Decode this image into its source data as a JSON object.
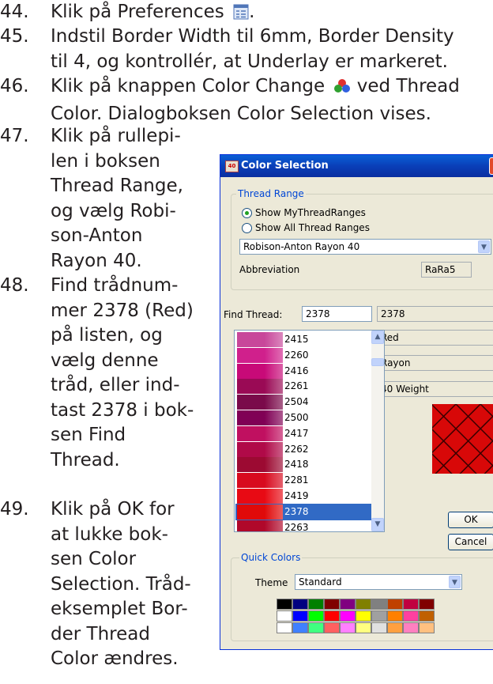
{
  "steps": [
    {
      "num": "44.",
      "lines": [
        "Klik på Preferences"
      ],
      "icon": "preferences-icon"
    },
    {
      "num": "45.",
      "lines": [
        "Indstil Border Width til 6mm, Border Density",
        "til 4, og kontrollér, at Underlay er markeret."
      ]
    },
    {
      "num": "46.",
      "lines": [
        "Klik på knappen Color Change",
        "Color. Dialogboksen Color Selection vises."
      ],
      "line1_tail": "ved Thread",
      "icon": "color-change-icon"
    },
    {
      "num": "47.",
      "lines": [
        "Klik på rullepi-",
        "len i boksen",
        "Thread Range,",
        "og vælg Robi-",
        "son-Anton",
        "Rayon 40."
      ]
    },
    {
      "num": "48.",
      "lines": [
        "Find trådnum-",
        "mer 2378 (Red)",
        "på listen, og",
        "vælg denne",
        "tråd, eller ind-",
        "tast 2378 i bok-",
        "sen Find",
        "Thread."
      ]
    },
    {
      "num": "49.",
      "lines": [
        "Klik på OK for",
        "at lukke bok-",
        "sen Color",
        "Selection. Tråd-",
        "eksemplet Bor-",
        "der Thread",
        "Color ændres."
      ]
    }
  ],
  "dialog": {
    "title": "Color Selection",
    "title_icon_text": "40",
    "close": "X",
    "thread_range": {
      "label": "Thread Range",
      "radio1": "Show MyThreadRanges",
      "radio2": "Show All Thread Ranges",
      "selected": "Robison-Anton Rayon 40",
      "abbr_label": "Abbreviation",
      "abbr_value": "RaRa5"
    },
    "find_label": "Find Thread:",
    "find_value": "2378",
    "info": [
      "2378",
      "Red",
      "Rayon",
      "40 Weight"
    ],
    "threads": [
      {
        "n": "2415",
        "c": "#c8479a"
      },
      {
        "n": "2260",
        "c": "#d0208c"
      },
      {
        "n": "2416",
        "c": "#c80a78"
      },
      {
        "n": "2261",
        "c": "#9a0a55"
      },
      {
        "n": "2504",
        "c": "#7a0a4a"
      },
      {
        "n": "2500",
        "c": "#800055"
      },
      {
        "n": "2417",
        "c": "#c01060"
      },
      {
        "n": "2262",
        "c": "#b00a48"
      },
      {
        "n": "2418",
        "c": "#9c0a32"
      },
      {
        "n": "2281",
        "c": "#d80a1e"
      },
      {
        "n": "2419",
        "c": "#e80a14"
      },
      {
        "n": "2378",
        "c": "#e00a0a",
        "selected": true
      },
      {
        "n": "2263",
        "c": "#b0082a"
      }
    ],
    "ok": "OK",
    "cancel": "Cancel",
    "quick_colors": {
      "label": "Quick Colors",
      "theme_label": "Theme",
      "theme_value": "Standard",
      "palette": [
        [
          "#000000",
          "#000080",
          "#008000",
          "#800000",
          "#800080",
          "#808000",
          "#808080",
          "#c04000",
          "#c00040",
          "#800000"
        ],
        [
          "#ffffff",
          "#0000ff",
          "#00ff00",
          "#ff0000",
          "#ff00ff",
          "#ffff00",
          "#a0a0a0",
          "#ff8000",
          "#ff40a0",
          "#c06000"
        ],
        [
          "#ffffff",
          "#4080ff",
          "#40ff80",
          "#ff6060",
          "#ff80ff",
          "#ffff80",
          "#e0e0e0",
          "#ffa040",
          "#ff80c0",
          "#ffc080"
        ]
      ]
    }
  }
}
